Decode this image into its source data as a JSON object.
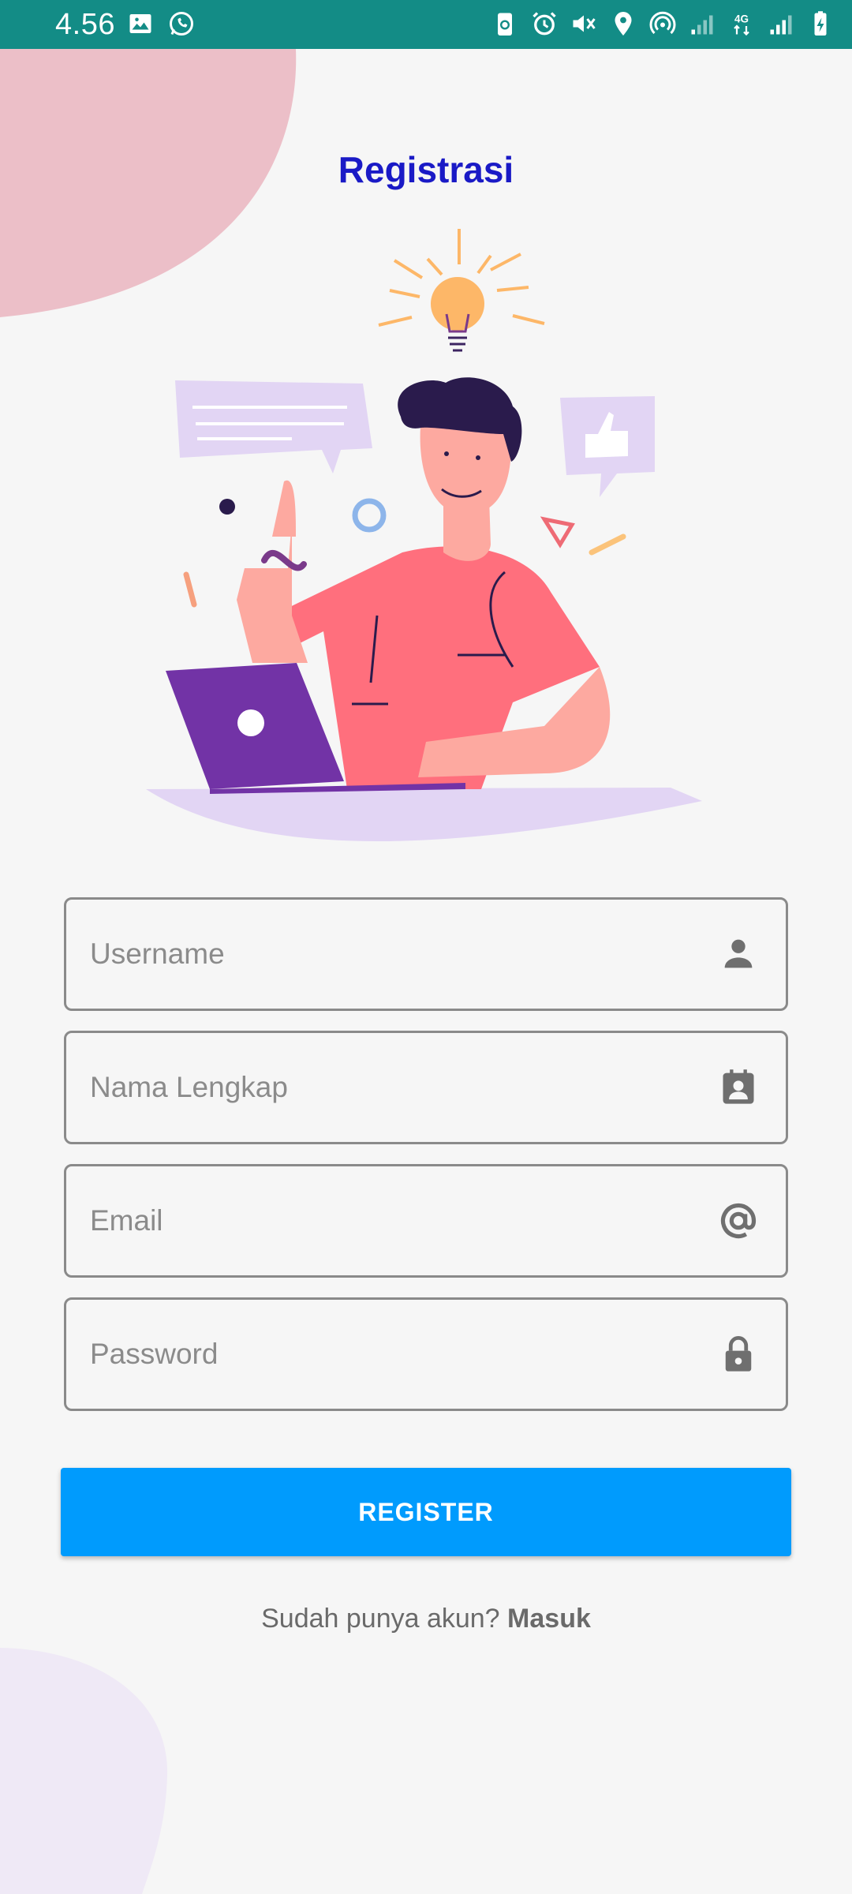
{
  "status_bar": {
    "time": "4.56",
    "network_label": "4G",
    "color": "#138c86"
  },
  "page": {
    "title": "Registrasi",
    "title_color": "#1a1ac6"
  },
  "form": {
    "username": {
      "placeholder": "Username",
      "icon": "person-icon"
    },
    "full_name": {
      "placeholder": "Nama Lengkap",
      "icon": "contact-card-icon"
    },
    "email": {
      "placeholder": "Email",
      "icon": "at-sign-icon"
    },
    "password": {
      "placeholder": "Password",
      "icon": "lock-icon"
    }
  },
  "register_button": {
    "label": "REGISTER",
    "color": "#009bfd"
  },
  "login_prompt": {
    "text": "Sudah punya akun?",
    "link_label": "Masuk"
  }
}
